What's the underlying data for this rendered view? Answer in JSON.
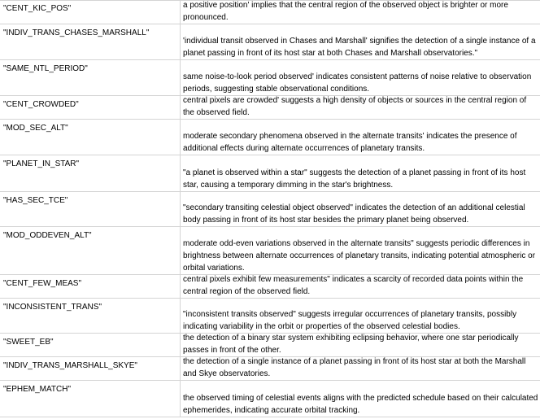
{
  "rows": [
    {
      "key": "\"CENT_KIC_POS\"",
      "desc": "a positive position' implies that the central region of the observed object is brighter or more pronounced."
    },
    {
      "key": "\"INDIV_TRANS_CHASES_MARSHALL\"",
      "desc": "'individual transit observed in Chases and Marshall' signifies the detection of a single instance of a planet passing in front of its host star at both Chases and Marshall observatories.\""
    },
    {
      "key": "\"SAME_NTL_PERIOD\"",
      "desc": "same noise-to-look period observed' indicates consistent patterns of noise relative to observation periods, suggesting stable observational conditions."
    },
    {
      "key": "\"CENT_CROWDED\"",
      "desc": "central pixels are crowded' suggests a high density of objects or sources in the central region of the observed field."
    },
    {
      "key": "\"MOD_SEC_ALT\"",
      "desc": "moderate secondary phenomena observed in the alternate transits' indicates the presence of additional effects during alternate occurrences of planetary transits."
    },
    {
      "key": "\"PLANET_IN_STAR\"",
      "desc": "\"a planet is observed within a star\" suggests the detection of a planet passing in front of its host star, causing a temporary dimming in the star's brightness."
    },
    {
      "key": "\"HAS_SEC_TCE\"",
      "desc": "\"secondary transiting celestial object observed\" indicates the detection of an additional celestial body passing in front of its host star besides the primary planet being observed."
    },
    {
      "key": "\"MOD_ODDEVEN_ALT\"",
      "desc": "moderate odd-even variations observed in the alternate transits\" suggests periodic differences in brightness between alternate occurrences of planetary transits, indicating potential atmospheric or orbital variations."
    },
    {
      "key": "\"CENT_FEW_MEAS\"",
      "desc": "central pixels exhibit few measurements\" indicates a scarcity of recorded data points within the central region of the observed field."
    },
    {
      "key": "\"INCONSISTENT_TRANS\"",
      "desc": "\"inconsistent transits observed\" suggests irregular occurrences of planetary transits, possibly indicating variability in the orbit or properties of the observed celestial bodies."
    },
    {
      "key": "\"SWEET_EB\"",
      "desc": "the detection of a binary star system exhibiting eclipsing behavior, where one star periodically passes in front of the other."
    },
    {
      "key": "\"INDIV_TRANS_MARSHALL_SKYE\"",
      "desc": "the detection of a single instance of a planet passing in front of its host star at both the Marshall and Skye observatories."
    },
    {
      "key": "\"EPHEM_MATCH\"",
      "desc": "the observed timing of celestial events aligns with the predicted schedule based on their calculated ephemerides, indicating accurate orbital tracking."
    }
  ]
}
